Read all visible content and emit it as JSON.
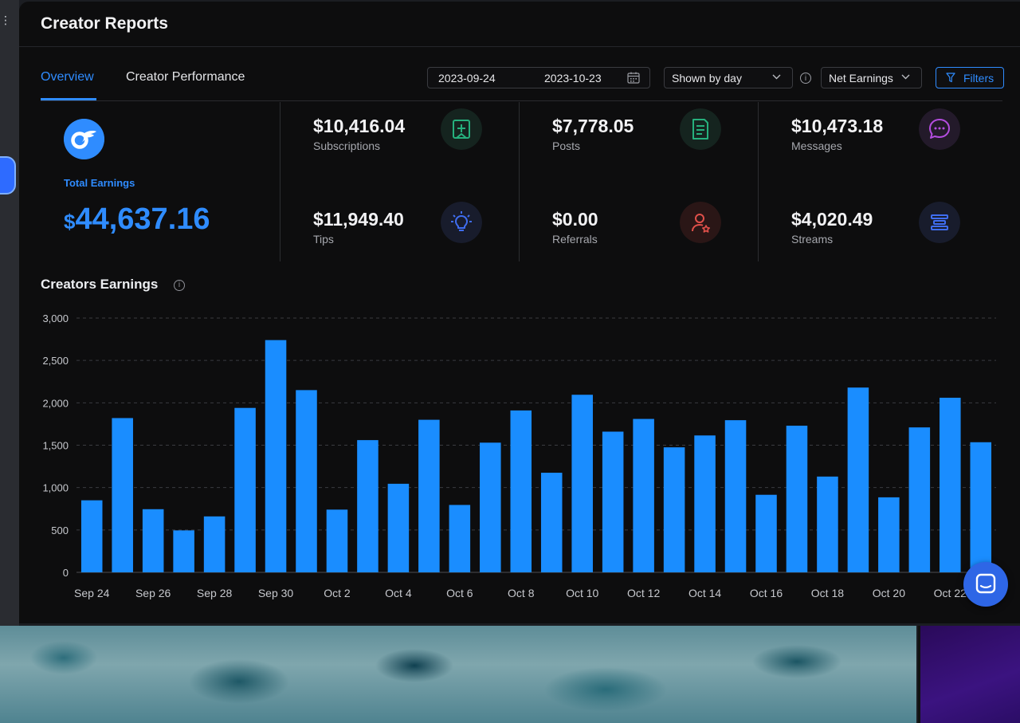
{
  "window": {
    "title": "Creator Reports"
  },
  "tabs": [
    {
      "label": "Overview",
      "active": true
    },
    {
      "label": "Creator Performance",
      "active": false
    }
  ],
  "controls": {
    "date_start": "2023-09-24",
    "date_end": "2023-10-23",
    "grouping": "Shown by day",
    "metric": "Net Earnings",
    "filters_label": "Filters"
  },
  "total": {
    "label": "Total Earnings",
    "currency": "$",
    "value": "44,637.16"
  },
  "stats": [
    {
      "value": "$10,416.04",
      "label": "Subscriptions",
      "icon": "add-post-icon",
      "color": "#26b07d"
    },
    {
      "value": "$7,778.05",
      "label": "Posts",
      "icon": "document-icon",
      "color": "#26b07d"
    },
    {
      "value": "$10,473.18",
      "label": "Messages",
      "icon": "chat-bubble-icon",
      "color": "#b44de0"
    },
    {
      "value": "$11,949.40",
      "label": "Tips",
      "icon": "lightbulb-icon",
      "color": "#3f6df0"
    },
    {
      "value": "$0.00",
      "label": "Referrals",
      "icon": "user-star-icon",
      "color": "#e0504a"
    },
    {
      "value": "$4,020.49",
      "label": "Streams",
      "icon": "stream-bars-icon",
      "color": "#3f6df0"
    }
  ],
  "section": {
    "title": "Creators Earnings"
  },
  "colors": {
    "accent": "#2f8cff",
    "bar": "#1a8dff"
  },
  "chart_data": {
    "type": "bar",
    "categories": [
      "Sep 24",
      "Sep 25",
      "Sep 26",
      "Sep 27",
      "Sep 28",
      "Sep 29",
      "Sep 30",
      "Oct 1",
      "Oct 2",
      "Oct 3",
      "Oct 4",
      "Oct 5",
      "Oct 6",
      "Oct 7",
      "Oct 8",
      "Oct 9",
      "Oct 10",
      "Oct 11",
      "Oct 12",
      "Oct 13",
      "Oct 14",
      "Oct 15",
      "Oct 16",
      "Oct 17",
      "Oct 18",
      "Oct 19",
      "Oct 20",
      "Oct 21",
      "Oct 22",
      "Oct 23"
    ],
    "tick_labels": [
      "Sep 24",
      "Sep 26",
      "Sep 28",
      "Sep 30",
      "Oct 2",
      "Oct 4",
      "Oct 6",
      "Oct 8",
      "Oct 10",
      "Oct 12",
      "Oct 14",
      "Oct 16",
      "Oct 18",
      "Oct 20",
      "Oct 22"
    ],
    "values": [
      850,
      1820,
      745,
      495,
      660,
      1940,
      2740,
      2150,
      740,
      1560,
      1045,
      1800,
      795,
      1530,
      1910,
      1175,
      2095,
      1660,
      1810,
      1475,
      1615,
      1795,
      915,
      1730,
      1130,
      2180,
      885,
      1710,
      2060,
      1535
    ],
    "yticks": [
      "0",
      "500",
      "1,000",
      "1,500",
      "2,000",
      "2,500",
      "3,000"
    ],
    "ylim": [
      0,
      3000
    ],
    "grid": true
  }
}
